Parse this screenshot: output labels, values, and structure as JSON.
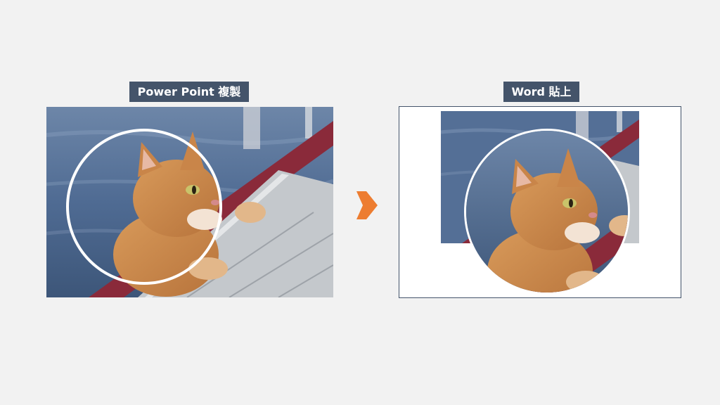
{
  "left_panel": {
    "title": "Power Point 複製"
  },
  "right_panel": {
    "title": "Word 貼上"
  },
  "arrow_icon": "arrow-right-icon",
  "colors": {
    "label_bg": "#44546a",
    "label_text": "#ffffff",
    "arrow": "#ed7d31",
    "frame_border": "#44546a"
  }
}
